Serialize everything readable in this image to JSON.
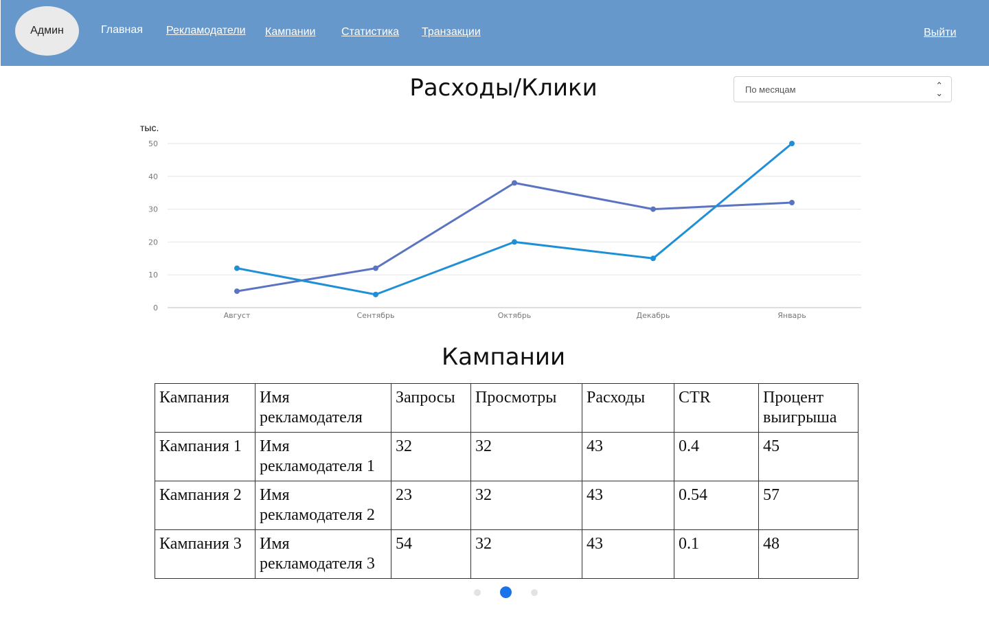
{
  "header": {
    "user_label": "Админ",
    "nav": [
      {
        "label": "Главная"
      },
      {
        "label": "Рекламодатели"
      },
      {
        "label": "Кампании"
      },
      {
        "label": "Статистика"
      },
      {
        "label": "Транзакции"
      }
    ],
    "logout_label": "Выйти",
    "background_color": "#6798cb"
  },
  "chart_section": {
    "title": "Расходы/Клики",
    "period_select": {
      "selected": "По месяцам",
      "icon": "up-down-chevron-icon"
    }
  },
  "chart_data": {
    "type": "line",
    "title": "",
    "ylabel": "тыс.",
    "xlabel": "",
    "categories": [
      "Август",
      "Сентябрь",
      "Октябрь",
      "Декабрь",
      "Январь"
    ],
    "ylim": [
      0,
      50
    ],
    "yticks": [
      0,
      10,
      20,
      30,
      40,
      50
    ],
    "grid": true,
    "series": [
      {
        "color": "#5b74c1",
        "values": [
          5,
          12,
          38,
          30,
          32
        ]
      },
      {
        "color": "#1f8fd6",
        "values": [
          12,
          4,
          20,
          15,
          50
        ]
      }
    ]
  },
  "table_section": {
    "title": "Кампании",
    "columns": [
      "Кампания",
      "Имя рекламодателя",
      "Запросы",
      "Просмотры",
      "Расходы",
      "CTR",
      "Процент выигрыша"
    ],
    "rows": [
      [
        "Кампания 1",
        "Имя рекламодателя 1",
        "32",
        "32",
        "43",
        "0.4",
        "45"
      ],
      [
        "Кампания 2",
        "Имя рекламодателя 2",
        "23",
        "32",
        "43",
        "0.54",
        "57"
      ],
      [
        "Кампания 3",
        "Имя рекламодателя 3",
        "54",
        "32",
        "43",
        "0.1",
        "48"
      ]
    ]
  },
  "pagination": {
    "pages": 3,
    "active_index": 1,
    "active_color": "#1a73e8"
  }
}
